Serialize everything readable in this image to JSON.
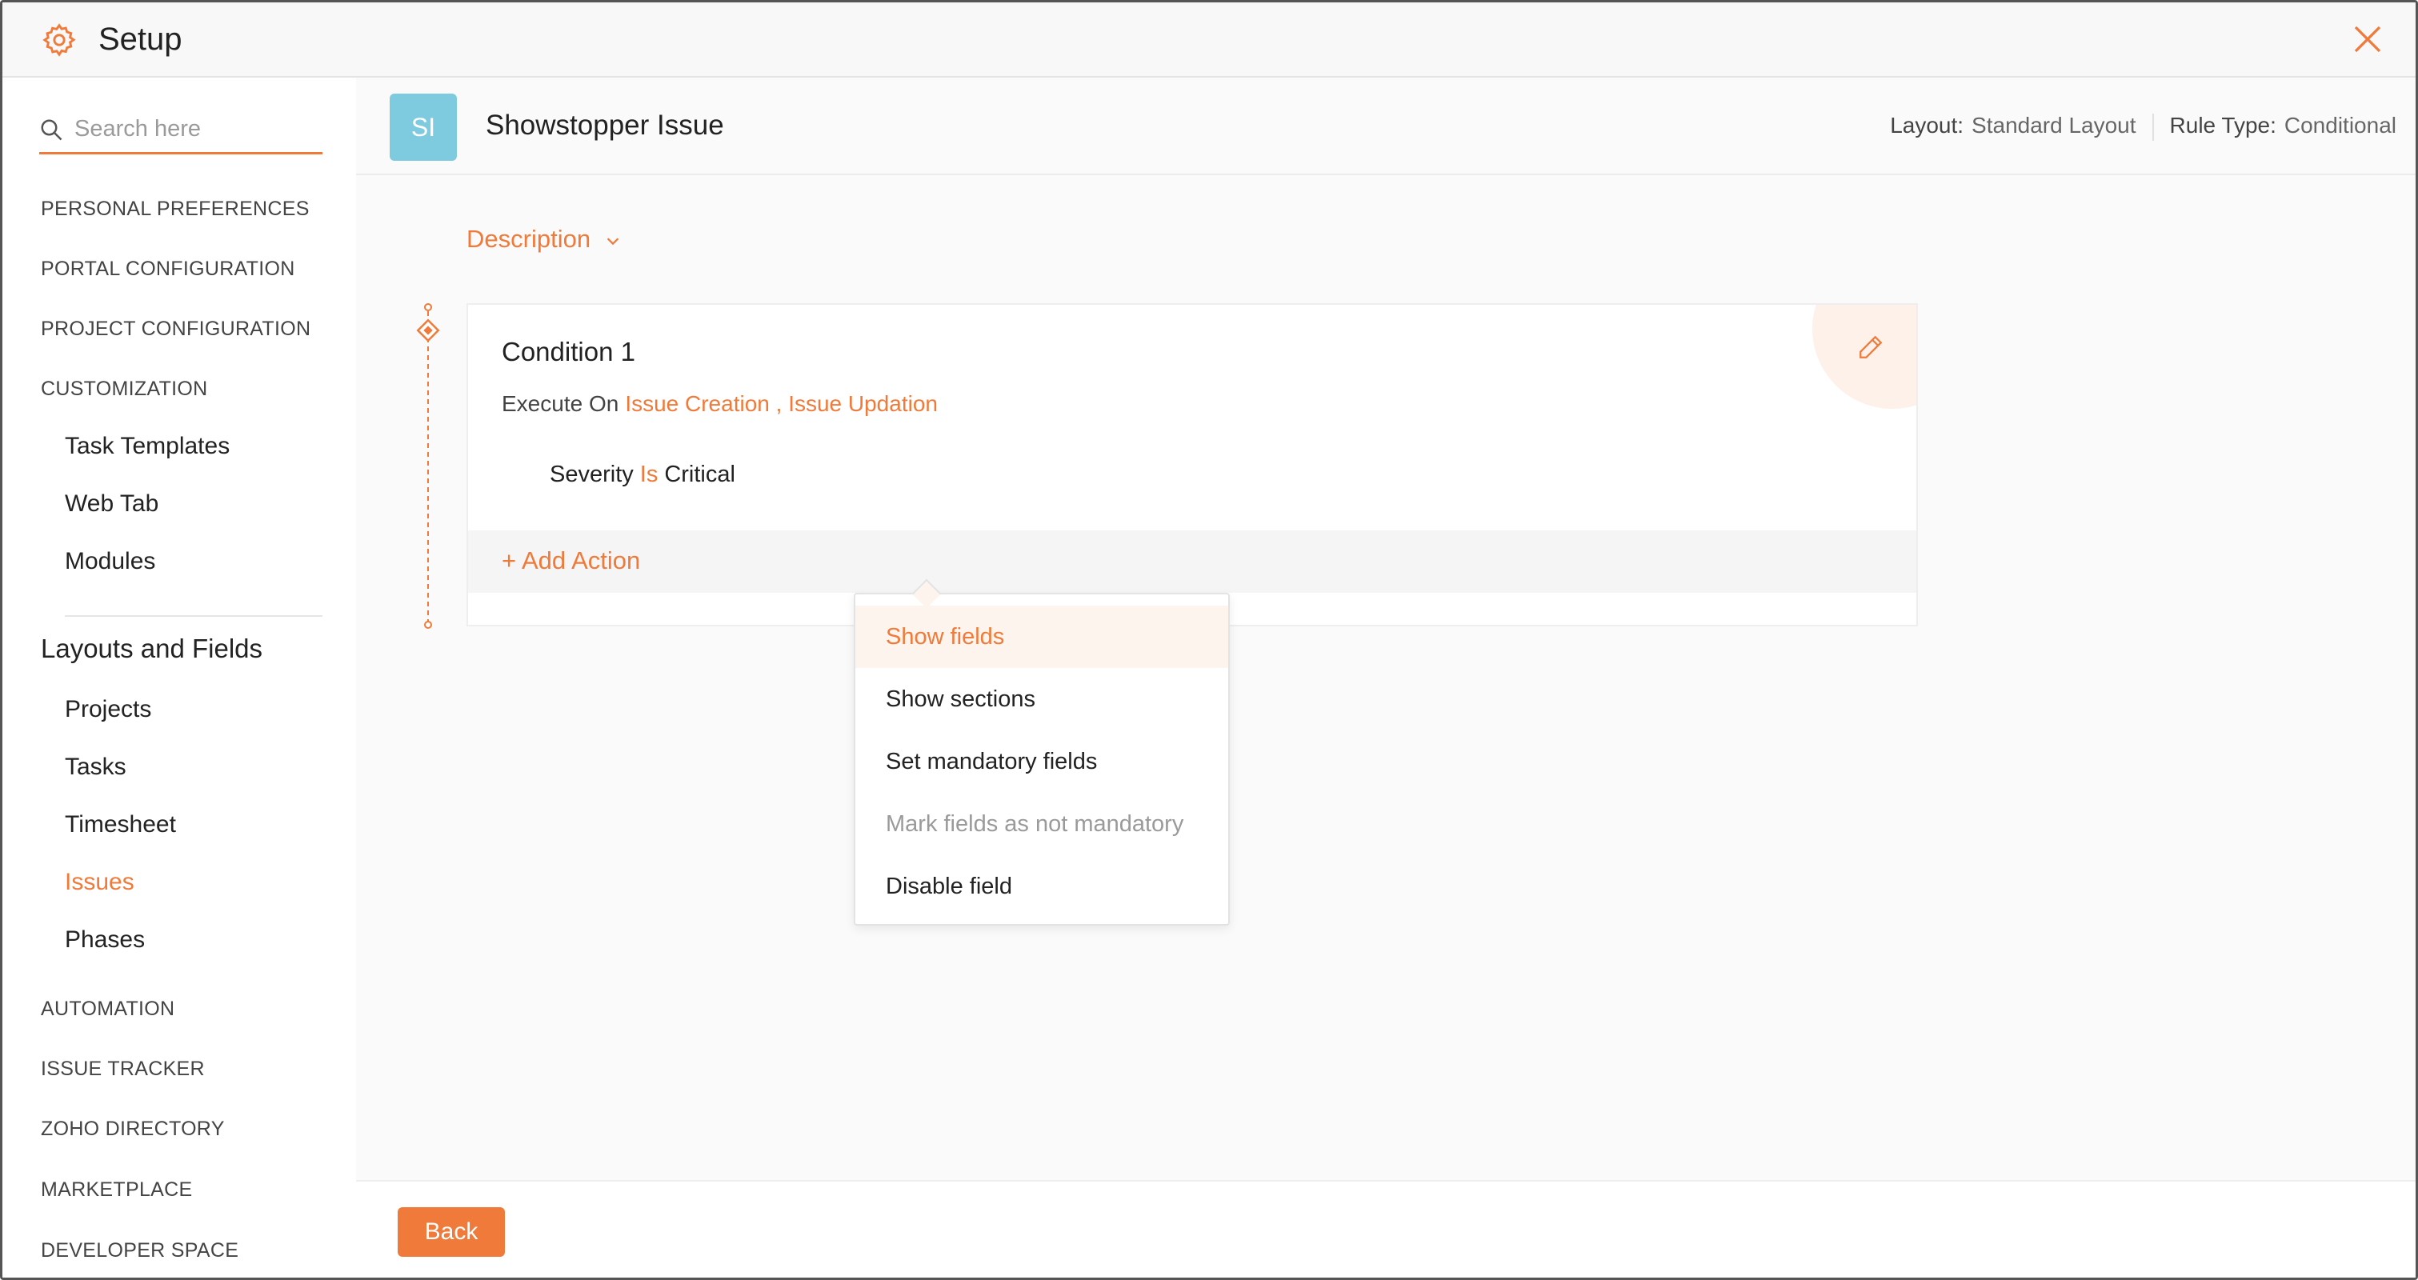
{
  "app": {
    "title": "Setup",
    "accent": "#f07a3a"
  },
  "search": {
    "placeholder": "Search here",
    "value": ""
  },
  "sidebar": {
    "items": [
      {
        "label": "PERSONAL PREFERENCES"
      },
      {
        "label": "PORTAL CONFIGURATION"
      },
      {
        "label": "PROJECT CONFIGURATION"
      },
      {
        "label": "CUSTOMIZATION"
      },
      {
        "label": "Task Templates"
      },
      {
        "label": "Web Tab"
      },
      {
        "label": "Modules"
      },
      {
        "label": "Layouts and Fields"
      },
      {
        "label": "Projects"
      },
      {
        "label": "Tasks"
      },
      {
        "label": "Timesheet"
      },
      {
        "label": "Issues",
        "active": true
      },
      {
        "label": "Phases"
      },
      {
        "label": "AUTOMATION"
      },
      {
        "label": "ISSUE TRACKER"
      },
      {
        "label": "ZOHO DIRECTORY"
      },
      {
        "label": "MARKETPLACE"
      },
      {
        "label": "DEVELOPER SPACE"
      }
    ]
  },
  "header": {
    "avatar": "SI",
    "avatar_color": "#7ecbe0",
    "title": "Showstopper Issue",
    "layout_label": "Layout:",
    "layout_value": "Standard Layout",
    "rule_type_label": "Rule Type:",
    "rule_type_value": "Conditional"
  },
  "description": {
    "label": "Description"
  },
  "condition": {
    "title": "Condition 1",
    "execute_on_label": "Execute On",
    "execute_on_value": "Issue Creation , Issue Updation",
    "criteria": {
      "field": "Severity",
      "operator": "Is",
      "value": "Critical"
    },
    "add_action_label": "+ Add Action"
  },
  "action_menu": {
    "items": [
      {
        "label": "Show fields",
        "state": "highlighted"
      },
      {
        "label": "Show sections",
        "state": "normal"
      },
      {
        "label": "Set mandatory fields",
        "state": "normal"
      },
      {
        "label": "Mark fields as not mandatory",
        "state": "disabled"
      },
      {
        "label": "Disable field",
        "state": "normal"
      }
    ]
  },
  "footer": {
    "back_label": "Back"
  }
}
